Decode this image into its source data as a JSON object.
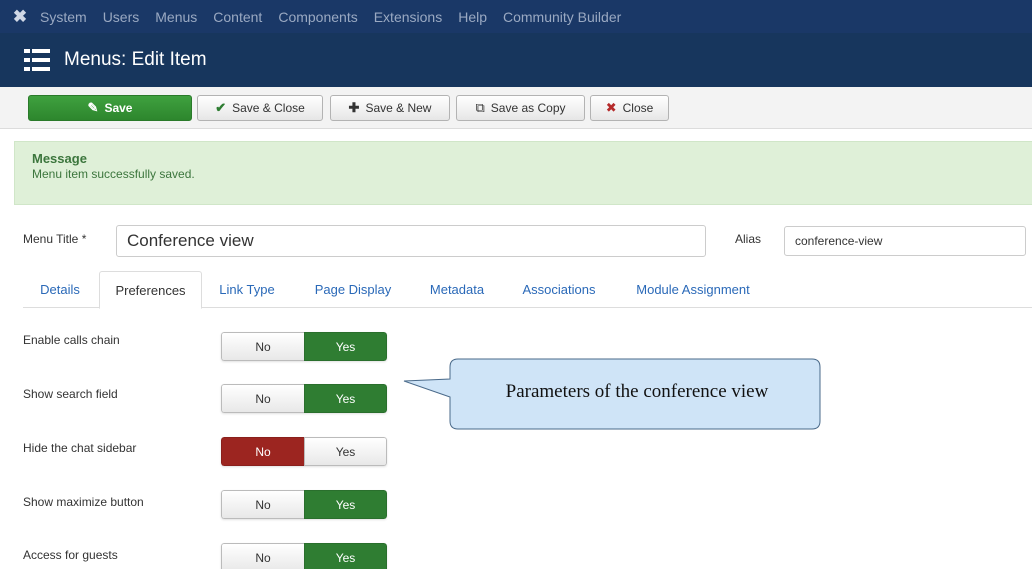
{
  "topnav": {
    "logo": "joomla-logo",
    "items": [
      "System",
      "Users",
      "Menus",
      "Content",
      "Components",
      "Extensions",
      "Help",
      "Community Builder"
    ]
  },
  "header": {
    "title": "Menus: Edit Item",
    "icon": "menu-list-icon"
  },
  "toolbar": {
    "save": "Save",
    "save_close": "Save & Close",
    "save_new": "Save & New",
    "save_copy": "Save as Copy",
    "close": "Close"
  },
  "message": {
    "title": "Message",
    "body": "Menu item successfully saved."
  },
  "form": {
    "title_label": "Menu Title *",
    "title_value": "Conference view",
    "alias_label": "Alias",
    "alias_value": "conference-view"
  },
  "tabs": [
    "Details",
    "Preferences",
    "Link Type",
    "Page Display",
    "Metadata",
    "Associations",
    "Module Assignment"
  ],
  "active_tab": "Preferences",
  "toggle_labels": {
    "no": "No",
    "yes": "Yes"
  },
  "preferences": [
    {
      "label": "Enable calls chain",
      "value": "Yes"
    },
    {
      "label": "Show search field",
      "value": "Yes"
    },
    {
      "label": "Hide the chat sidebar",
      "value": "No"
    },
    {
      "label": "Show maximize button",
      "value": "Yes"
    },
    {
      "label": "Access for guests",
      "value": "Yes"
    }
  ],
  "callout": {
    "text": "Parameters of the conference view"
  },
  "colors": {
    "nav_bg": "#1a3867",
    "title_bg": "#17365d",
    "save_green": "#2d862d",
    "yes_green": "#2f7d32",
    "no_red": "#9c2520",
    "message_bg": "#dff0d8",
    "callout_fill": "#cfe4f7"
  }
}
